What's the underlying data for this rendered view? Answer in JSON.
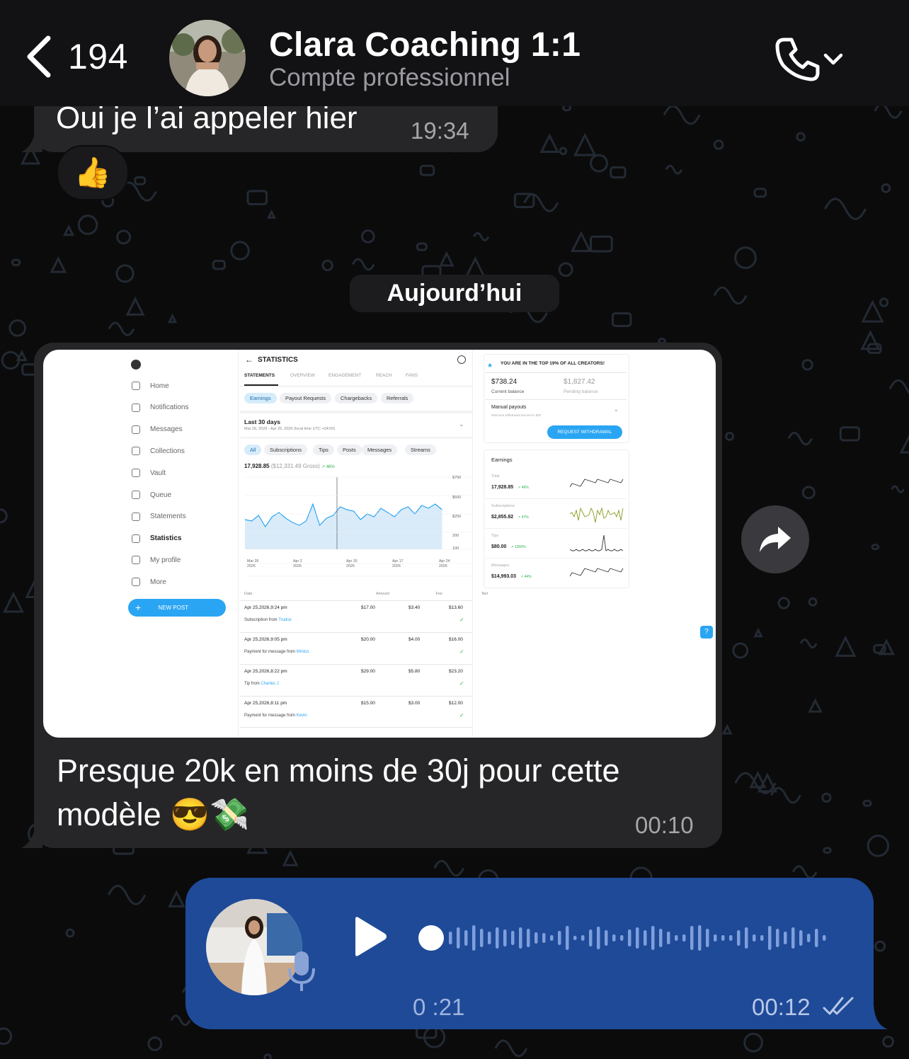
{
  "header": {
    "back_count": "194",
    "title": "Clara Coaching 1:1",
    "subtitle": "Compte professionnel"
  },
  "messages": {
    "m1": {
      "text": "Oui je l’ai appeler hier",
      "time": "19:34",
      "reaction": "👍"
    },
    "date_separator": "Aujourd’hui",
    "m2": {
      "caption": "Presque 20k en moins de 30j pour cette modèle 😎💸",
      "time": "00:10"
    },
    "voice": {
      "duration": "0 :21",
      "time": "00:12",
      "progress": 0
    }
  },
  "screenshot": {
    "sidebar": [
      "Home",
      "Notifications",
      "Messages",
      "Collections",
      "Vault",
      "Queue",
      "Statements",
      "Statistics",
      "My profile",
      "More"
    ],
    "new_post": "NEW POST",
    "page_title": "STATISTICS",
    "tabs": [
      "STATEMENTS",
      "OVERVIEW",
      "ENGAGEMENT",
      "REACH",
      "FANS"
    ],
    "subtabs": [
      "Earnings",
      "Payout Requests",
      "Chargebacks",
      "Referrals"
    ],
    "period": "Last 30 days",
    "period_detail": "Mar 26, 2026 - Apr 25, 2026 (local time UTC +04:00)",
    "filters": [
      "All",
      "Subscriptions",
      "Tips",
      "Posts",
      "Messages",
      "Streams"
    ],
    "total": "17,928.85",
    "total_gross": "($12,331.49 Gross)",
    "total_change": "↗ 46%",
    "y_ticks": [
      "$750",
      "$500",
      "$250",
      "200",
      "100"
    ],
    "x_ticks": [
      "Mar 26, 2026",
      "Apr 2, 2026",
      "Apr 10, 2026",
      "Apr 17, 2026",
      "Apr 24, 2026"
    ],
    "table_headers": [
      "Date",
      "Amount",
      "Fee",
      "Net"
    ],
    "rows": [
      {
        "date": "Apr 25,2026,9:24 pm",
        "amount": "$17.00",
        "fee": "$3.40",
        "net": "$13.60",
        "desc": "Subscription from ",
        "who": "Trudox"
      },
      {
        "date": "Apr 25,2026,9:05 pm",
        "amount": "$20.00",
        "fee": "$4.00",
        "net": "$16.00",
        "desc": "Payment for message from ",
        "who": "Mmico"
      },
      {
        "date": "Apr 25,2026,8:22 pm",
        "amount": "$29.00",
        "fee": "$5.80",
        "net": "$23.20",
        "desc": "Tip from ",
        "who": "Charles J"
      },
      {
        "date": "Apr 25,2026,8:11 pm",
        "amount": "$15.00",
        "fee": "$3.00",
        "net": "$12.00",
        "desc": "Payment for message from ",
        "who": "Kevin"
      }
    ],
    "banner": "YOU ARE IN THE TOP 19% OF ALL CREATORS!",
    "current_balance": "$738.24",
    "current_balance_label": "Current balance",
    "pending_balance": "$1,827.42",
    "pending_balance_label": "Pending balance",
    "manual_payouts": "Manual payouts",
    "min_withdrawal": "Minimum withdrawal amount is $20",
    "withdraw_btn": "REQUEST WITHDRAWAL",
    "earnings_title": "Earnings",
    "earnings": [
      {
        "label": "Total",
        "value": "17,928.85",
        "change": "↗ 46%"
      },
      {
        "label": "Subscriptions",
        "value": "$2,855.82",
        "change": "↗ 47%"
      },
      {
        "label": "Tips",
        "value": "$80.00",
        "change": "↗ 1300%"
      },
      {
        "label": "Messages",
        "value": "$14,993.03",
        "change": "↗ 44%"
      }
    ]
  },
  "colors": {
    "accent": "#00aff0",
    "voice_bubble": "#1e4a98",
    "incoming_bubble": "#262628"
  },
  "icons": [
    "chevron-left-icon",
    "phone-icon",
    "chevron-down-icon",
    "forward-icon",
    "play-icon",
    "mic-icon",
    "double-check-icon"
  ]
}
